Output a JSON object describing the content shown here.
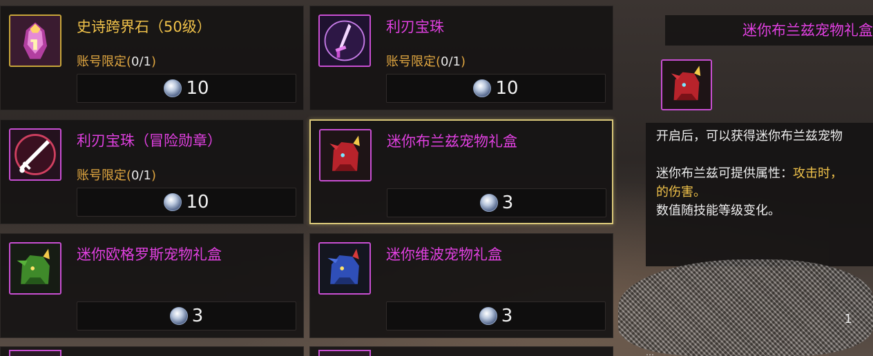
{
  "shop_items": [
    {
      "title": "史诗跨界石（50级）",
      "limit_label": "账号限定(",
      "limit_value": "0/1",
      "limit_close": ")",
      "price": "10",
      "icon": "epic-stone-icon"
    },
    {
      "title": "利刃宝珠",
      "limit_label": "账号限定(",
      "limit_value": "0/1",
      "limit_close": ")",
      "price": "10",
      "icon": "blade-orb-icon"
    },
    {
      "title": "利刃宝珠（冒险勋章）",
      "limit_label": "账号限定(",
      "limit_value": "0/1",
      "limit_close": ")",
      "price": "10",
      "icon": "blade-orb-medal-icon"
    },
    {
      "title": "迷你布兰兹宠物礼盒",
      "price": "3",
      "icon": "red-pet-icon"
    },
    {
      "title": "迷你欧格罗斯宠物礼盒",
      "price": "3",
      "icon": "green-pet-icon"
    },
    {
      "title": "迷你维波宠物礼盒",
      "price": "3",
      "icon": "blue-pet-icon"
    }
  ],
  "detail": {
    "title": "迷你布兰兹宠物礼盒",
    "icon": "red-pet-icon",
    "line1": "开启后，可以获得迷你布兰兹宠物",
    "line2_prefix": "迷你布兰兹可提供属性：",
    "line2_gold": "攻击时，",
    "line3_gold": "的伤害。",
    "line4": "数值随技能等级变化。",
    "count": "1"
  },
  "footer_text": "…",
  "colors": {
    "gold": "#f0c24a",
    "magenta": "#e040e0",
    "limit_orange": "#e0a640",
    "selected_border": "#d9c779"
  }
}
